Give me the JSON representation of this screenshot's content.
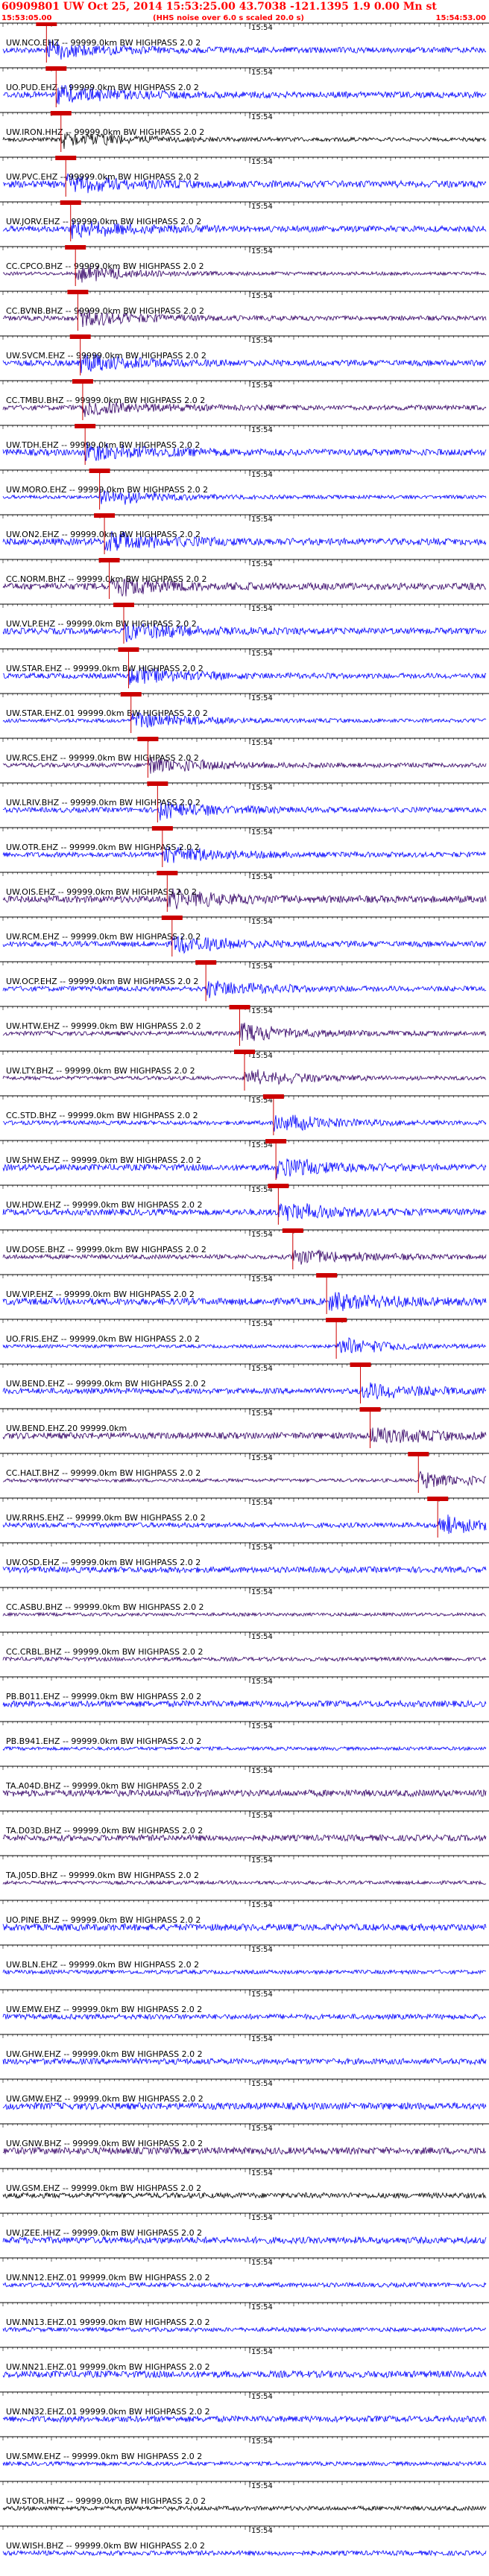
{
  "header": {
    "title": "60909801 UW Oct 25, 2014 15:53:25.00   43.7038 -121.1395   1.9 0.00 Mn st",
    "window_start": "15:53:05.00",
    "note": "(HHS noise over 6.0 s scaled 20.0 s)",
    "window_end": "15:54:53.00"
  },
  "colors": {
    "header": "#ff0000",
    "pick": "#cc0000",
    "blue": "#0000ff",
    "dark": "#330066",
    "black": "#000000"
  },
  "chart_data": {
    "type": "line",
    "time_label": "15:54",
    "traces": [
      {
        "label": "UW.NCO.EHZ -- 99999.0km BW  HIGHPASS  2.0  2",
        "color": "#0000ff",
        "pick": 0.09
      },
      {
        "label": "UO.PUD.EHZ -- 99999.0km BW  HIGHPASS  2.0  2",
        "color": "#0000ff",
        "pick": 0.11
      },
      {
        "label": "UW.IRON.HHZ -- 99999.0km BW  HIGHPASS  2.0  2",
        "color": "#000000",
        "pick": 0.12
      },
      {
        "label": "UW.PVC.EHZ -- 99999.0km BW  HIGHPASS  2.0  2",
        "color": "#0000ff",
        "pick": 0.13
      },
      {
        "label": "UW.JORV.EHZ -- 99999.0km BW  HIGHPASS  2.0  2",
        "color": "#0000ff",
        "pick": 0.14
      },
      {
        "label": "CC.CPCO.BHZ -- 99999.0km BW  HIGHPASS  2.0  2",
        "color": "#330066",
        "pick": 0.15
      },
      {
        "label": "CC.BVNB.BHZ -- 99999.0km BW  HIGHPASS  2.0  2",
        "color": "#330066",
        "pick": 0.155
      },
      {
        "label": "UW.SVCM.EHZ -- 99999.0km BW  HIGHPASS  2.0  2",
        "color": "#0000ff",
        "pick": 0.16
      },
      {
        "label": "CC.TMBU.BHZ -- 99999.0km BW  HIGHPASS  2.0  2",
        "color": "#330066",
        "pick": 0.165
      },
      {
        "label": "UW.TDH.EHZ -- 99999.0km BW  HIGHPASS  2.0  2",
        "color": "#0000ff",
        "pick": 0.17
      },
      {
        "label": "UW.MORO.EHZ -- 99999.0km BW  HIGHPASS  2.0  2",
        "color": "#0000ff",
        "pick": 0.2
      },
      {
        "label": "UW.ON2.EHZ -- 99999.0km BW  HIGHPASS  2.0  2",
        "color": "#0000ff",
        "pick": 0.21
      },
      {
        "label": "CC.NORM.BHZ -- 99999.0km BW  HIGHPASS  2.0  2",
        "color": "#330066",
        "pick": 0.22
      },
      {
        "label": "UW.VLP.EHZ -- 99999.0km BW  HIGHPASS  2.0  2",
        "color": "#0000ff",
        "pick": 0.25
      },
      {
        "label": "UW.STAR.EHZ -- 99999.0km BW  HIGHPASS  2.0  2",
        "color": "#0000ff",
        "pick": 0.26
      },
      {
        "label": "UW.STAR.EHZ.01 99999.0km BW  HIGHPASS  2.0  2",
        "color": "#0000ff",
        "pick": 0.265
      },
      {
        "label": "UW.RCS.EHZ -- 99999.0km BW  HIGHPASS  2.0  2",
        "color": "#330066",
        "pick": 0.3
      },
      {
        "label": "UW.LRIV.BHZ -- 99999.0km BW  HIGHPASS  2.0  2",
        "color": "#0000ff",
        "pick": 0.32
      },
      {
        "label": "UW.OTR.EHZ -- 99999.0km BW  HIGHPASS  2.0  2",
        "color": "#0000ff",
        "pick": 0.33
      },
      {
        "label": "UW.OIS.EHZ -- 99999.0km BW  HIGHPASS  2.0  2",
        "color": "#330066",
        "pick": 0.34
      },
      {
        "label": "UW.RCM.EHZ -- 99999.0km BW  HIGHPASS  2.0  2",
        "color": "#0000ff",
        "pick": 0.35
      },
      {
        "label": "UW.OCP.EHZ -- 99999.0km BW  HIGHPASS  2.0  2",
        "color": "#0000ff",
        "pick": 0.42
      },
      {
        "label": "UW.HTW.EHZ -- 99999.0km BW  HIGHPASS  2.0  2",
        "color": "#330066",
        "pick": 0.49
      },
      {
        "label": "UW.LTY.BHZ -- 99999.0km BW  HIGHPASS  2.0  2",
        "color": "#330066",
        "pick": 0.5
      },
      {
        "label": "CC.STD.BHZ -- 99999.0km BW  HIGHPASS  2.0  2",
        "color": "#0000ff",
        "pick": 0.56
      },
      {
        "label": "UW.SHW.EHZ -- 99999.0km BW  HIGHPASS  2.0  2",
        "color": "#0000ff",
        "pick": 0.565
      },
      {
        "label": "UW.HDW.EHZ -- 99999.0km BW  HIGHPASS  2.0  2",
        "color": "#0000ff",
        "pick": 0.57
      },
      {
        "label": "UW.DOSE.BHZ -- 99999.0km BW  HIGHPASS  2.0  2",
        "color": "#330066",
        "pick": 0.6
      },
      {
        "label": "UW.VIP.EHZ -- 99999.0km BW  HIGHPASS  2.0  2",
        "color": "#0000ff",
        "pick": 0.67
      },
      {
        "label": "UO.FRIS.EHZ -- 99999.0km BW  HIGHPASS  2.0  2",
        "color": "#0000ff",
        "pick": 0.69
      },
      {
        "label": "UW.BEND.EHZ -- 99999.0km BW  HIGHPASS  2.0  2",
        "color": "#0000ff",
        "pick": 0.74
      },
      {
        "label": "UW.BEND.EHZ.20 99999.0km",
        "color": "#330066",
        "pick": 0.76
      },
      {
        "label": "CC.HALT.BHZ -- 99999.0km BW  HIGHPASS  2.0  2",
        "color": "#330066",
        "pick": 0.86
      },
      {
        "label": "UW.RRHS.EHZ -- 99999.0km BW  HIGHPASS  2.0  2",
        "color": "#0000ff",
        "pick": 0.9
      },
      {
        "label": "UW.OSD.EHZ -- 99999.0km BW  HIGHPASS  2.0  2",
        "color": "#0000ff",
        "pick": null
      },
      {
        "label": "CC.ASBU.BHZ -- 99999.0km BW  HIGHPASS  2.0  2",
        "color": "#330066",
        "pick": null
      },
      {
        "label": "CC.CRBL.BHZ -- 99999.0km BW  HIGHPASS  2.0  2",
        "color": "#330066",
        "pick": null
      },
      {
        "label": "PB.B011.EHZ -- 99999.0km BW  HIGHPASS  2.0  2",
        "color": "#0000ff",
        "pick": null
      },
      {
        "label": "PB.B941.EHZ -- 99999.0km BW  HIGHPASS  2.0  2",
        "color": "#0000ff",
        "pick": null
      },
      {
        "label": "TA.A04D.BHZ -- 99999.0km BW  HIGHPASS  2.0  2",
        "color": "#330066",
        "pick": null
      },
      {
        "label": "TA.D03D.BHZ -- 99999.0km BW  HIGHPASS  2.0  2",
        "color": "#330066",
        "pick": null
      },
      {
        "label": "TA.J05D.BHZ -- 99999.0km BW  HIGHPASS  2.0  2",
        "color": "#330066",
        "pick": null
      },
      {
        "label": "UO.PINE.BHZ -- 99999.0km BW  HIGHPASS  2.0  2",
        "color": "#0000ff",
        "pick": null
      },
      {
        "label": "UW.BLN.EHZ -- 99999.0km BW  HIGHPASS  2.0  2",
        "color": "#0000ff",
        "pick": null
      },
      {
        "label": "UW.EMW.EHZ -- 99999.0km BW  HIGHPASS  2.0  2",
        "color": "#0000ff",
        "pick": null
      },
      {
        "label": "UW.GHW.EHZ -- 99999.0km BW  HIGHPASS  2.0  2",
        "color": "#0000ff",
        "pick": null
      },
      {
        "label": "UW.GMW.EHZ -- 99999.0km BW  HIGHPASS  2.0  2",
        "color": "#0000ff",
        "pick": null
      },
      {
        "label": "UW.GNW.BHZ -- 99999.0km BW  HIGHPASS  2.0  2",
        "color": "#330066",
        "pick": null
      },
      {
        "label": "UW.GSM.EHZ -- 99999.0km BW  HIGHPASS  2.0  2",
        "color": "#000000",
        "pick": null
      },
      {
        "label": "UW.JZEE.HHZ -- 99999.0km BW  HIGHPASS  2.0  2",
        "color": "#0000ff",
        "pick": null
      },
      {
        "label": "UW.NN12.EHZ.01 99999.0km BW  HIGHPASS  2.0  2",
        "color": "#0000ff",
        "pick": null
      },
      {
        "label": "UW.NN13.EHZ.01 99999.0km BW  HIGHPASS  2.0  2",
        "color": "#0000ff",
        "pick": null
      },
      {
        "label": "UW.NN21.EHZ.01 99999.0km BW  HIGHPASS  2.0  2",
        "color": "#0000ff",
        "pick": null
      },
      {
        "label": "UW.NN32.EHZ.01 99999.0km BW  HIGHPASS  2.0  2",
        "color": "#0000ff",
        "pick": null
      },
      {
        "label": "UW.SMW.EHZ -- 99999.0km BW  HIGHPASS  2.0  2",
        "color": "#0000ff",
        "pick": null
      },
      {
        "label": "UW.STOR.HHZ -- 99999.0km BW  HIGHPASS  2.0  2",
        "color": "#000000",
        "pick": null
      },
      {
        "label": "UW.WISH.BHZ -- 99999.0km BW  HIGHPASS  2.0  2",
        "color": "#0000ff",
        "pick": null
      }
    ]
  }
}
